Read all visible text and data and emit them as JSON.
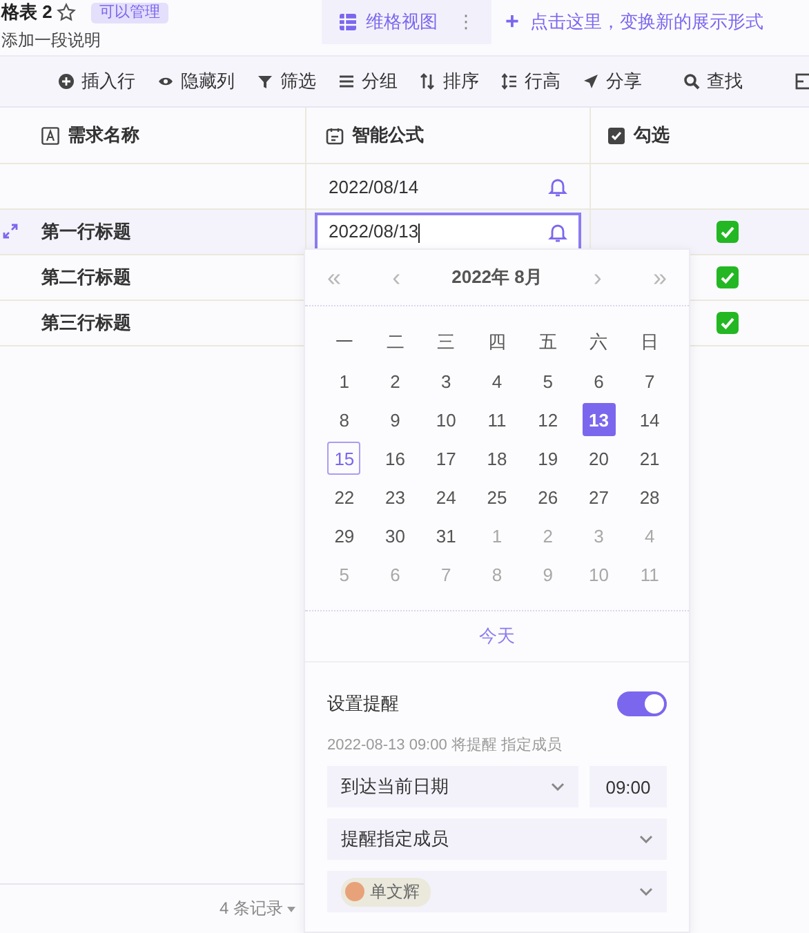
{
  "header": {
    "title": "格表 2",
    "badge": "可以管理",
    "description": "添加一段说明",
    "view_tab": {
      "label": "维格视图",
      "more": "⋮",
      "selected": true
    },
    "add_view": {
      "icon": "+",
      "label": "点击这里，变换新的展示形式"
    }
  },
  "toolbar": [
    {
      "kind": "insert",
      "label": "插入行"
    },
    {
      "kind": "hide",
      "label": "隐藏列"
    },
    {
      "kind": "filter",
      "label": "筛选"
    },
    {
      "kind": "group",
      "label": "分组"
    },
    {
      "kind": "sort",
      "label": "排序"
    },
    {
      "kind": "height",
      "label": "行高"
    },
    {
      "kind": "share",
      "label": "分享"
    },
    {
      "kind": "find",
      "label": "查找"
    }
  ],
  "table": {
    "columns": [
      {
        "kind": "text",
        "label": "需求名称"
      },
      {
        "kind": "date",
        "label": "智能公式"
      },
      {
        "kind": "check",
        "label": "勾选"
      }
    ],
    "rows": [
      {
        "name": "",
        "date": "2022/08/14",
        "editing": false,
        "checked": false
      },
      {
        "name": "第一行标题",
        "date": "2022/08/13",
        "editing": true,
        "checked": true
      },
      {
        "name": "第二行标题",
        "date": "",
        "editing": false,
        "checked": true
      },
      {
        "name": "第三行标题",
        "date": "",
        "editing": false,
        "checked": true
      }
    ]
  },
  "footer": {
    "count": "4 条记录"
  },
  "date_picker": {
    "nav": {
      "prev_year": "«",
      "prev_month": "‹",
      "title": "2022年 8月",
      "next_month": "›",
      "next_year": "»"
    },
    "weekdays": [
      "一",
      "二",
      "三",
      "四",
      "五",
      "六",
      "日"
    ],
    "weeks": [
      [
        {
          "d": "1",
          "kind": "in",
          "selected": false,
          "today": false
        },
        {
          "d": "2",
          "kind": "in",
          "selected": false,
          "today": false
        },
        {
          "d": "3",
          "kind": "in",
          "selected": false,
          "today": false
        },
        {
          "d": "4",
          "kind": "in",
          "selected": false,
          "today": false
        },
        {
          "d": "5",
          "kind": "in",
          "selected": false,
          "today": false
        },
        {
          "d": "6",
          "kind": "in",
          "selected": false,
          "today": false
        },
        {
          "d": "7",
          "kind": "in",
          "selected": false,
          "today": false
        }
      ],
      [
        {
          "d": "8",
          "kind": "in",
          "selected": false,
          "today": false
        },
        {
          "d": "9",
          "kind": "in",
          "selected": false,
          "today": false
        },
        {
          "d": "10",
          "kind": "in",
          "selected": false,
          "today": false
        },
        {
          "d": "11",
          "kind": "in",
          "selected": false,
          "today": false
        },
        {
          "d": "12",
          "kind": "in",
          "selected": false,
          "today": false
        },
        {
          "d": "13",
          "kind": "in",
          "selected": true,
          "today": false
        },
        {
          "d": "14",
          "kind": "in",
          "selected": false,
          "today": false
        }
      ],
      [
        {
          "d": "15",
          "kind": "in",
          "selected": false,
          "today": true
        },
        {
          "d": "16",
          "kind": "in",
          "selected": false,
          "today": false
        },
        {
          "d": "17",
          "kind": "in",
          "selected": false,
          "today": false
        },
        {
          "d": "18",
          "kind": "in",
          "selected": false,
          "today": false
        },
        {
          "d": "19",
          "kind": "in",
          "selected": false,
          "today": false
        },
        {
          "d": "20",
          "kind": "in",
          "selected": false,
          "today": false
        },
        {
          "d": "21",
          "kind": "in",
          "selected": false,
          "today": false
        }
      ],
      [
        {
          "d": "22",
          "kind": "in",
          "selected": false,
          "today": false
        },
        {
          "d": "23",
          "kind": "in",
          "selected": false,
          "today": false
        },
        {
          "d": "24",
          "kind": "in",
          "selected": false,
          "today": false
        },
        {
          "d": "25",
          "kind": "in",
          "selected": false,
          "today": false
        },
        {
          "d": "26",
          "kind": "in",
          "selected": false,
          "today": false
        },
        {
          "d": "27",
          "kind": "in",
          "selected": false,
          "today": false
        },
        {
          "d": "28",
          "kind": "in",
          "selected": false,
          "today": false
        }
      ],
      [
        {
          "d": "29",
          "kind": "in",
          "selected": false,
          "today": false
        },
        {
          "d": "30",
          "kind": "in",
          "selected": false,
          "today": false
        },
        {
          "d": "31",
          "kind": "in",
          "selected": false,
          "today": false
        },
        {
          "d": "1",
          "kind": "out",
          "selected": false,
          "today": false
        },
        {
          "d": "2",
          "kind": "out",
          "selected": false,
          "today": false
        },
        {
          "d": "3",
          "kind": "out",
          "selected": false,
          "today": false
        },
        {
          "d": "4",
          "kind": "out",
          "selected": false,
          "today": false
        }
      ],
      [
        {
          "d": "5",
          "kind": "out",
          "selected": false,
          "today": false
        },
        {
          "d": "6",
          "kind": "out",
          "selected": false,
          "today": false
        },
        {
          "d": "7",
          "kind": "out",
          "selected": false,
          "today": false
        },
        {
          "d": "8",
          "kind": "out",
          "selected": false,
          "today": false
        },
        {
          "d": "9",
          "kind": "out",
          "selected": false,
          "today": false
        },
        {
          "d": "10",
          "kind": "out",
          "selected": false,
          "today": false
        },
        {
          "d": "11",
          "kind": "out",
          "selected": false,
          "today": false
        }
      ]
    ],
    "today_button": "今天",
    "reminder": {
      "label": "设置提醒",
      "on": true,
      "info": "2022-08-13 09:00 将提醒 指定成员",
      "when": "到达当前日期",
      "time": "09:00",
      "target": "提醒指定成员",
      "member": "单文辉"
    }
  }
}
